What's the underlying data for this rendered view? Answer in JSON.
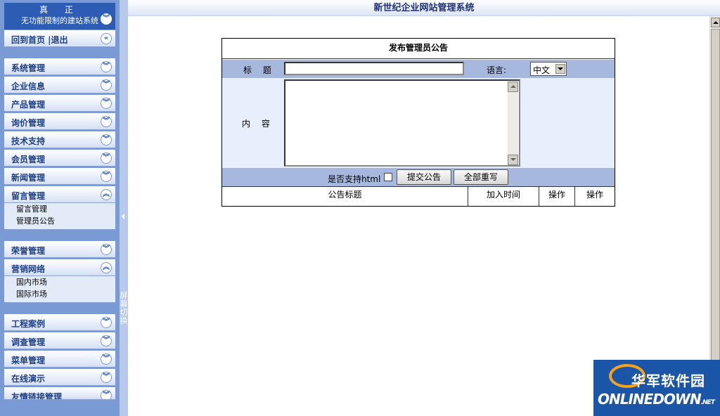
{
  "app": {
    "title": "新世纪企业网站管理系统"
  },
  "sidebar": {
    "header_line1": "真 正",
    "header_line2": "无功能限制的建站系统",
    "quick_links": "回到首页 |退出",
    "items": [
      {
        "label": "系统管理",
        "expanded": false
      },
      {
        "label": "企业信息",
        "expanded": false
      },
      {
        "label": "产品管理",
        "expanded": false
      },
      {
        "label": "询价管理",
        "expanded": false
      },
      {
        "label": "技术支持",
        "expanded": false
      },
      {
        "label": "会员管理",
        "expanded": false
      },
      {
        "label": "新闻管理",
        "expanded": false
      },
      {
        "label": "留言管理",
        "expanded": true,
        "sub": [
          "留言管理",
          "管理员公告"
        ]
      },
      {
        "label": "荣誉管理",
        "expanded": false
      },
      {
        "label": "营销网络",
        "expanded": true,
        "sub": [
          "国内市场",
          "国际市场"
        ]
      },
      {
        "label": "工程案例",
        "expanded": false
      },
      {
        "label": "调查管理",
        "expanded": false
      },
      {
        "label": "菜单管理",
        "expanded": false
      },
      {
        "label": "在线演示",
        "expanded": false
      },
      {
        "label": "友情链接管理",
        "expanded": false
      }
    ],
    "toggle_text": "屏幕切换"
  },
  "form": {
    "heading": "发布管理员公告",
    "title_label": "标 题",
    "title_value": "",
    "language_label": "语言:",
    "language_value": "中文",
    "content_label": "内 容",
    "content_value": "",
    "html_label": "是否支持html",
    "html_checked": false,
    "submit_label": "提交公告",
    "reset_label": "全部重写"
  },
  "table": {
    "columns": [
      "公告标题",
      "加入时间",
      "操作",
      "操作"
    ],
    "rows": []
  },
  "watermark": {
    "cn": "华军软件园",
    "en": "ONLINEDOWN",
    "suffix": ".NET"
  },
  "colors": {
    "sidebar_bg": "#7a9ad6",
    "header_bg": "#2c5cb4",
    "row_bg": "#a6b8dd",
    "accent": "#1c3f86"
  }
}
